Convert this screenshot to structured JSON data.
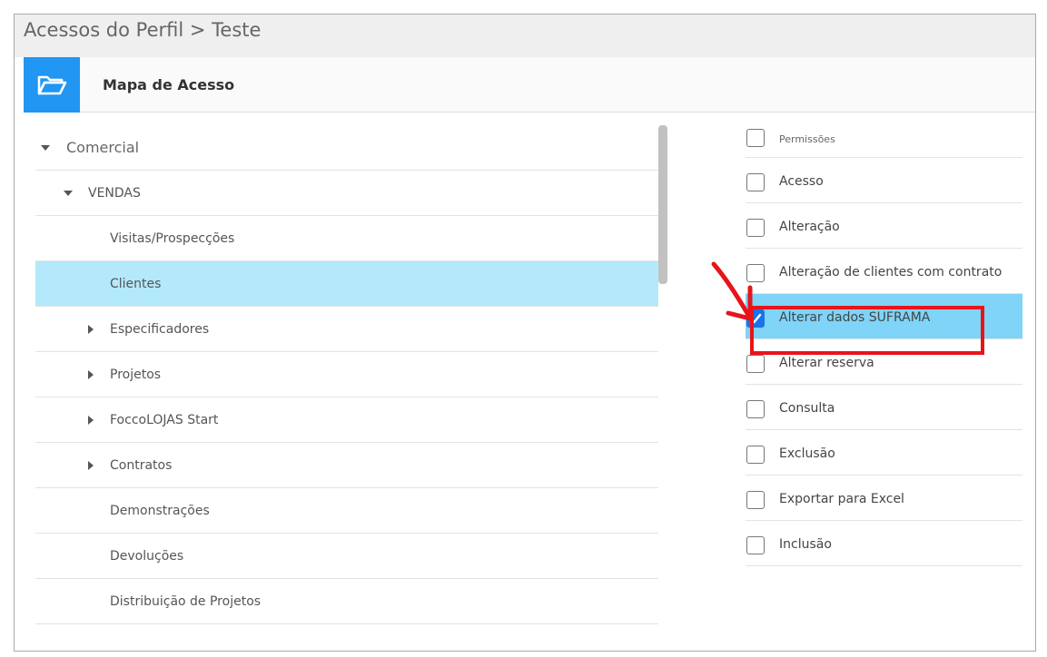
{
  "page": {
    "title": "Acessos do Perfil > Teste"
  },
  "panel": {
    "title": "Mapa de Acesso",
    "icon": "folder-open-icon",
    "accent": "#2196f3"
  },
  "tree": {
    "items": [
      {
        "label": "Comercial",
        "level": 0,
        "caret": "down"
      },
      {
        "label": "VENDAS",
        "level": 1,
        "caret": "down"
      },
      {
        "label": "Visitas/Prospecções",
        "level": 2,
        "caret": "none"
      },
      {
        "label": "Clientes",
        "level": 2,
        "caret": "none",
        "selected": true
      },
      {
        "label": "Especificadores",
        "level": 2,
        "caret": "right"
      },
      {
        "label": "Projetos",
        "level": 2,
        "caret": "right"
      },
      {
        "label": "FoccoLOJAS Start",
        "level": 2,
        "caret": "right"
      },
      {
        "label": "Contratos",
        "level": 2,
        "caret": "right"
      },
      {
        "label": "Demonstrações",
        "level": 2,
        "caret": "none"
      },
      {
        "label": "Devoluções",
        "level": 2,
        "caret": "none"
      },
      {
        "label": "Distribuição de Projetos",
        "level": 2,
        "caret": "none"
      }
    ]
  },
  "permissions": {
    "header": "Permissões",
    "items": [
      {
        "label": "Acesso",
        "checked": false
      },
      {
        "label": "Alteração",
        "checked": false
      },
      {
        "label": "Alteração de clientes com contrato",
        "checked": false
      },
      {
        "label": "Alterar dados SUFRAMA",
        "checked": true
      },
      {
        "label": "Alterar reserva",
        "checked": false
      },
      {
        "label": "Consulta",
        "checked": false
      },
      {
        "label": "Exclusão",
        "checked": false
      },
      {
        "label": "Exportar para Excel",
        "checked": false
      },
      {
        "label": "Inclusão",
        "checked": false
      }
    ]
  },
  "colors": {
    "selected_row": "#b3e9fb",
    "checked_row": "#7fd4f7",
    "annotation": "#e8141a"
  }
}
